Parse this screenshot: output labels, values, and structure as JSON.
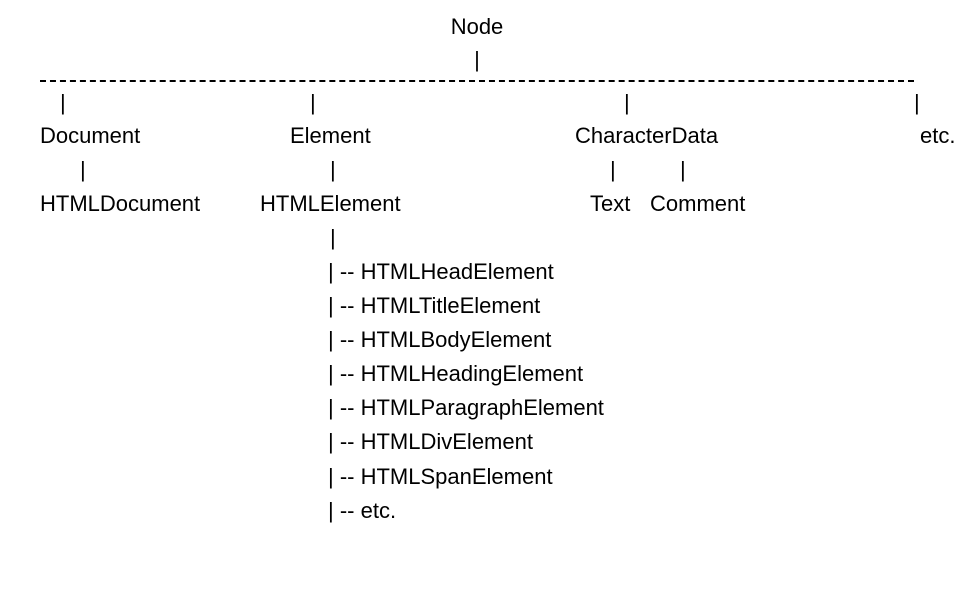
{
  "root": "Node",
  "pipe": "|",
  "level1": {
    "a": "Document",
    "b": "Element",
    "c": "CharacterData",
    "d": "etc."
  },
  "level2": {
    "a": "HTMLDocument",
    "b": "HTMLElement",
    "c1": "Text",
    "c2": "Comment"
  },
  "sublist": {
    "i1": "| -- HTMLHeadElement",
    "i2": "| -- HTMLTitleElement",
    "i3": "| -- HTMLBodyElement",
    "i4": "| -- HTMLHeadingElement",
    "i5": "| -- HTMLParagraphElement",
    "i6": "| -- HTMLDivElement",
    "i7": "| -- HTMLSpanElement",
    "i8": "| -- etc."
  }
}
